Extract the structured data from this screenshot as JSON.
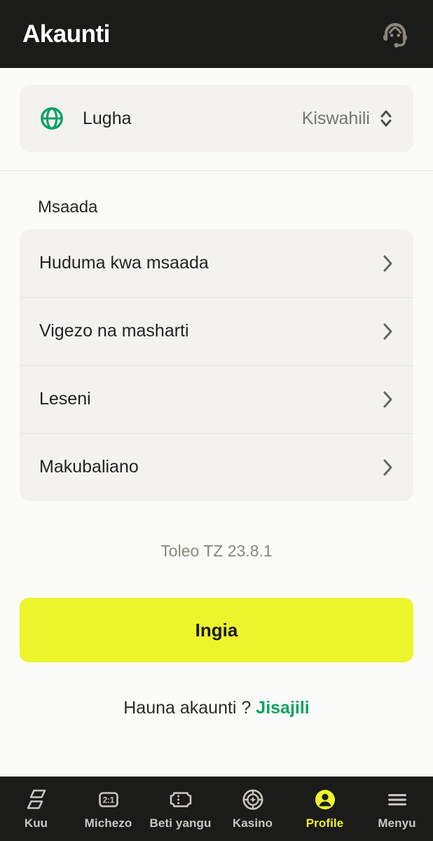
{
  "header": {
    "title": "Akaunti",
    "support_icon": "headset-support-icon"
  },
  "language": {
    "icon": "globe-icon",
    "label": "Lugha",
    "value": "Kiswahili",
    "selector_icon": "unfold-more-icon"
  },
  "help": {
    "section_title": "Msaada",
    "items": [
      {
        "label": "Huduma kwa msaada",
        "icon": "chevron-right-icon"
      },
      {
        "label": "Vigezo na masharti",
        "icon": "chevron-right-icon"
      },
      {
        "label": "Leseni",
        "icon": "chevron-right-icon"
      },
      {
        "label": "Makubaliano",
        "icon": "chevron-right-icon"
      }
    ]
  },
  "version": "Toleo TZ 23.8.1",
  "auth": {
    "login_label": "Ingia",
    "signup_prompt": "Hauna akaunti ?",
    "signup_link": "Jisajili"
  },
  "bottom_nav": {
    "items": [
      {
        "label": "Kuu",
        "icon": "home-panels-icon",
        "active": false
      },
      {
        "label": "Michezo",
        "icon": "odds-board-icon",
        "active": false
      },
      {
        "label": "Beti yangu",
        "icon": "ticket-icon",
        "active": false
      },
      {
        "label": "Kasino",
        "icon": "casino-chip-icon",
        "active": false
      },
      {
        "label": "Profile",
        "icon": "person-circle-icon",
        "active": true
      },
      {
        "label": "Menyu",
        "icon": "hamburger-menu-icon",
        "active": false
      }
    ]
  },
  "colors": {
    "accent_yellow": "#edf42c",
    "accent_green": "#11a161",
    "header_bg": "#1b1b1a",
    "page_bg": "#fbfbf9",
    "card_bg": "#f3f2ef"
  }
}
